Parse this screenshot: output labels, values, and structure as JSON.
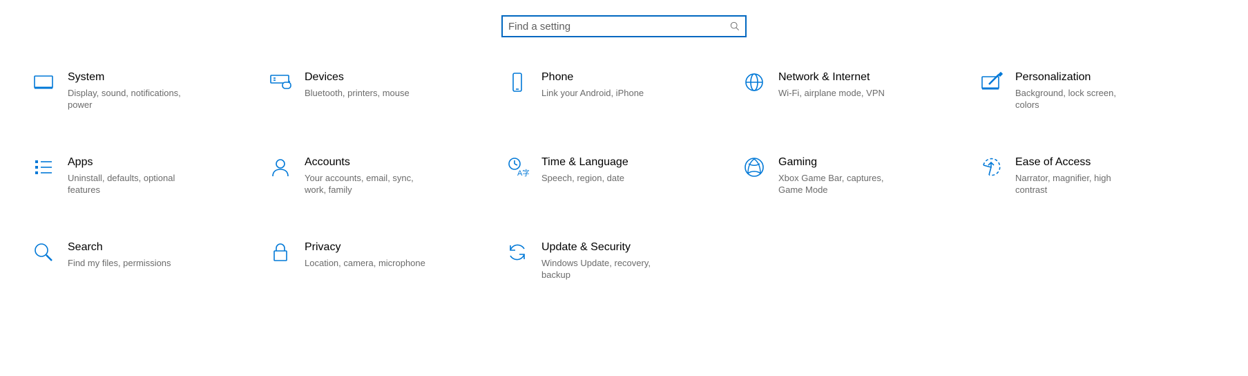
{
  "search": {
    "placeholder": "Find a setting"
  },
  "categories": [
    {
      "icon": "system-icon",
      "title": "System",
      "desc": "Display, sound, notifications, power"
    },
    {
      "icon": "devices-icon",
      "title": "Devices",
      "desc": "Bluetooth, printers, mouse"
    },
    {
      "icon": "phone-icon",
      "title": "Phone",
      "desc": "Link your Android, iPhone"
    },
    {
      "icon": "network-icon",
      "title": "Network & Internet",
      "desc": "Wi-Fi, airplane mode, VPN"
    },
    {
      "icon": "personalization-icon",
      "title": "Personalization",
      "desc": "Background, lock screen, colors"
    },
    {
      "icon": "apps-icon",
      "title": "Apps",
      "desc": "Uninstall, defaults, optional features"
    },
    {
      "icon": "accounts-icon",
      "title": "Accounts",
      "desc": "Your accounts, email, sync, work, family"
    },
    {
      "icon": "time-language-icon",
      "title": "Time & Language",
      "desc": "Speech, region, date"
    },
    {
      "icon": "gaming-icon",
      "title": "Gaming",
      "desc": "Xbox Game Bar, captures, Game Mode"
    },
    {
      "icon": "ease-of-access-icon",
      "title": "Ease of Access",
      "desc": "Narrator, magnifier, high contrast"
    },
    {
      "icon": "search-icon",
      "title": "Search",
      "desc": "Find my files, permissions"
    },
    {
      "icon": "privacy-icon",
      "title": "Privacy",
      "desc": "Location, camera, microphone"
    },
    {
      "icon": "update-security-icon",
      "title": "Update & Security",
      "desc": "Windows Update, recovery, backup"
    }
  ]
}
